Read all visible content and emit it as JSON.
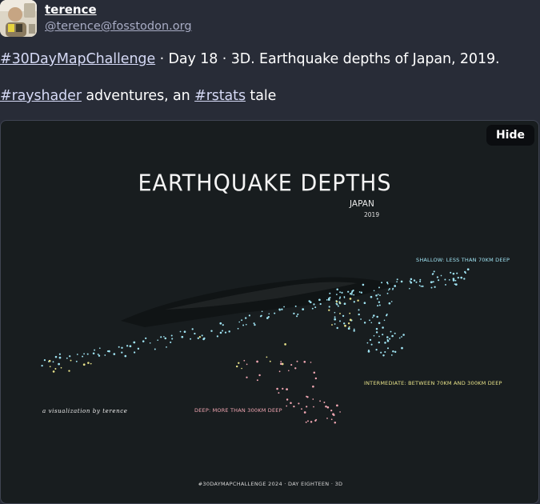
{
  "author": {
    "display_name": "terence",
    "handle": "@terence@fosstodon.org",
    "avatar_icon": "person-avatar-photo"
  },
  "status": {
    "line1": [
      {
        "text": "#30DayMapChallenge",
        "hashtag": true
      },
      {
        "text": " · Day 18 · 3D. Earthquake depths of Japan, 2019.",
        "hashtag": false
      }
    ],
    "line2": [
      {
        "text": "#rayshader",
        "hashtag": true
      },
      {
        "text": " adventures, an ",
        "hashtag": false
      },
      {
        "text": "#rstats",
        "hashtag": true
      },
      {
        "text": " tale",
        "hashtag": false
      }
    ]
  },
  "media": {
    "hide_label": "Hide",
    "map": {
      "title": "EARTHQUAKE DEPTHS",
      "subtitle": "JAPAN",
      "year": "2019",
      "shallow_label": "SHALLOW: LESS THAN 70KM DEEP",
      "intermediate_label": "INTERMEDIATE: BETWEEN 70KM AND 300KM DEEP",
      "deep_label": "DEEP: MORE THAN 300KM DEEP",
      "credit": "a visualization by terence",
      "footer": "#30DAYMAPCHALLENGE 2024 · DAY EIGHTEEN · 3D"
    },
    "colors": {
      "background": "#181d1f",
      "shallow": "#9fe3f2",
      "intermediate": "#e8e38a",
      "deep": "#f2a7b3"
    }
  }
}
